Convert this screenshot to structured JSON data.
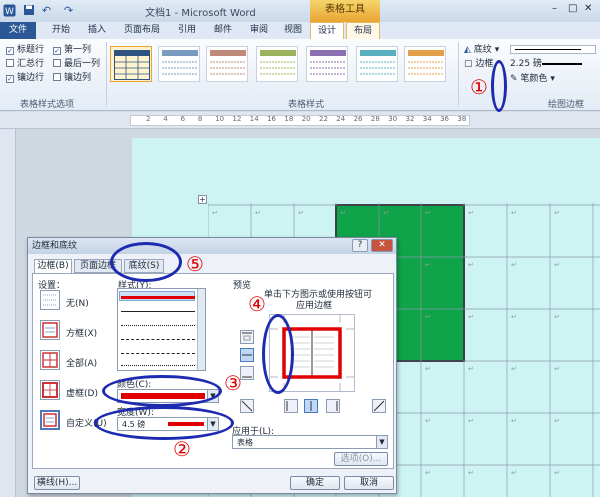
{
  "window": {
    "title": "文档1 - Microsoft Word",
    "contextual_tab": "表格工具"
  },
  "tabs": [
    "文件",
    "开始",
    "插入",
    "页面布局",
    "引用",
    "邮件",
    "审阅",
    "视图",
    "设计",
    "布局"
  ],
  "ribbon": {
    "options": [
      {
        "label": "标题行",
        "checked": true
      },
      {
        "label": "第一列",
        "checked": true
      },
      {
        "label": "汇总行",
        "checked": false
      },
      {
        "label": "最后一列",
        "checked": false
      },
      {
        "label": "镶边行",
        "checked": true
      },
      {
        "label": "镶边列",
        "checked": false
      }
    ],
    "group_options": "表格样式选项",
    "group_styles": "表格样式",
    "shading": "底纹",
    "borders": "边框",
    "weight": "2.25 磅",
    "pen_color": "笔颜色",
    "group_draw": "绘图边框"
  },
  "ruler": {
    "ticks": [
      "2",
      "4",
      "6",
      "8",
      "10",
      "12",
      "14",
      "16",
      "18",
      "20",
      "22",
      "24",
      "26",
      "28",
      "30",
      "32",
      "34",
      "36",
      "38"
    ]
  },
  "dialog": {
    "title": "边框和底纹",
    "help": "?",
    "close": "✕",
    "tabs": [
      "边框(B)",
      "页面边框(P)",
      "底纹(S)"
    ],
    "setting_label": "设置：",
    "settings": [
      "无(N)",
      "方框(X)",
      "全部(A)",
      "虚框(D)",
      "自定义(U)"
    ],
    "style_label": "样式(Y):",
    "color_label": "颜色(C):",
    "width_label": "宽度(W):",
    "width_value": "4.5 磅",
    "preview_label": "预览",
    "preview_hint_1": "单击下方图示或使用按钮可",
    "preview_hint_2": "应用边框",
    "apply_label": "应用于(L):",
    "apply_value": "表格",
    "options_button": "选项(O)...",
    "hline_button": "横线(H)...",
    "ok_button": "确定",
    "cancel_button": "取消"
  },
  "annotations": [
    "①",
    "②",
    "③",
    "④",
    "⑤"
  ],
  "colors": {
    "accent": "#2b579a",
    "green_cells": "#0fa34a",
    "page": "#cdf3f3",
    "marker": "#e00000",
    "circle": "#1d2bb0"
  }
}
